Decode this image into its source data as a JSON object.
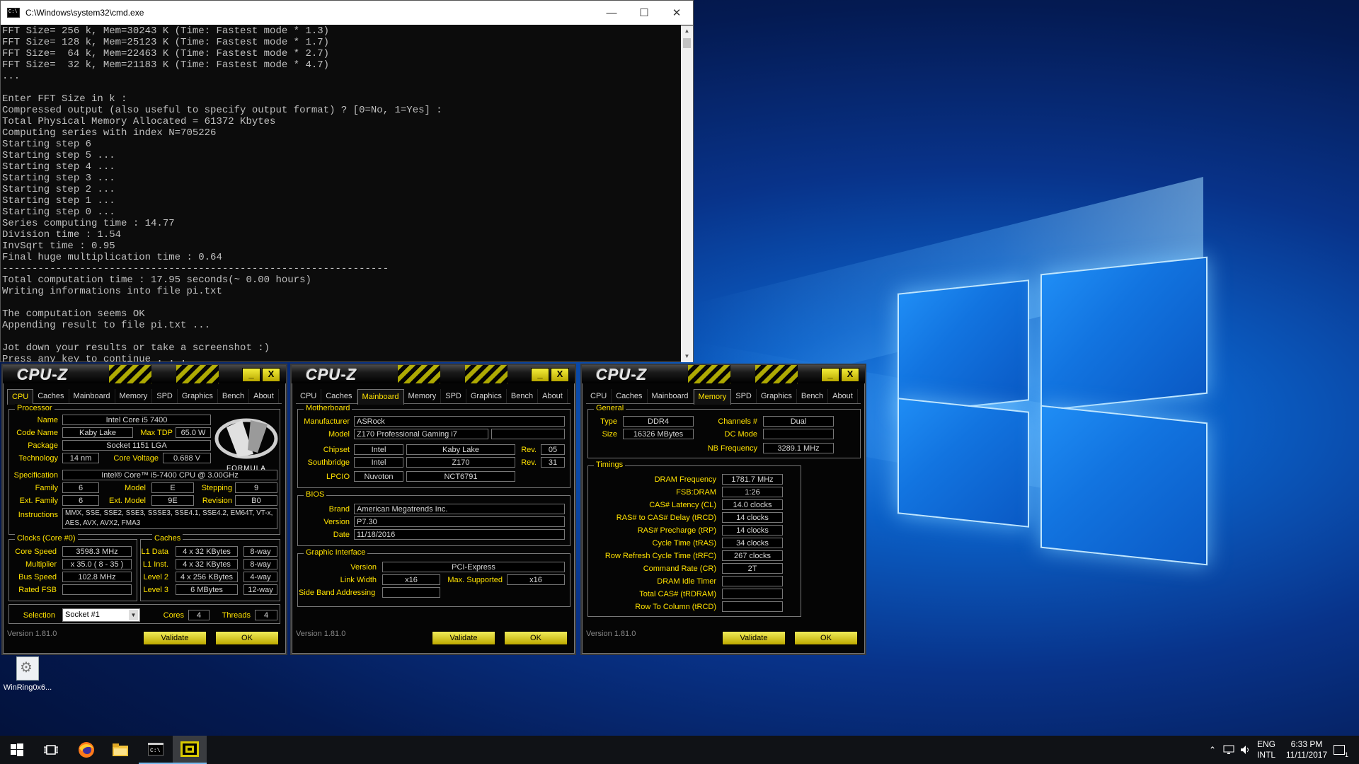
{
  "cmd": {
    "title": "C:\\Windows\\system32\\cmd.exe",
    "lines": [
      "FFT Size= 256 k, Mem=30243 K (Time: Fastest mode * 1.3)",
      "FFT Size= 128 k, Mem=25123 K (Time: Fastest mode * 1.7)",
      "FFT Size=  64 k, Mem=22463 K (Time: Fastest mode * 2.7)",
      "FFT Size=  32 k, Mem=21183 K (Time: Fastest mode * 4.7)",
      "...",
      "",
      "Enter FFT Size in k :",
      "Compressed output (also useful to specify output format) ? [0=No, 1=Yes] :",
      "Total Physical Memory Allocated = 61372 Kbytes",
      "Computing series with index N=705226",
      "Starting step 6",
      "Starting step 5 ...",
      "Starting step 4 ...",
      "Starting step 3 ...",
      "Starting step 2 ...",
      "Starting step 1 ...",
      "Starting step 0 ...",
      "Series computing time : 14.77",
      "Division time : 1.54",
      "InvSqrt time : 0.95",
      "Final huge multiplication time : 0.64",
      "-----------------------------------------------------------------",
      "Total computation time : 17.95 seconds(~ 0.00 hours)",
      "Writing informations into file pi.txt",
      "",
      "The computation seems OK",
      "Appending result to file pi.txt ...",
      "",
      "Jot down your results or take a screenshot :)",
      "Press any key to continue . . ."
    ]
  },
  "desktop": {
    "icon_label": "WinRing0x6..."
  },
  "cpuz_common": {
    "logo": "CPU-Z",
    "tabs": [
      "CPU",
      "Caches",
      "Mainboard",
      "Memory",
      "SPD",
      "Graphics",
      "Bench",
      "About"
    ],
    "version": "Version 1.81.0",
    "validate": "Validate",
    "ok": "OK",
    "minimize": "_",
    "close": "X"
  },
  "cpu": {
    "processor_title": "Processor",
    "name_lbl": "Name",
    "name": "Intel Core i5 7400",
    "codename_lbl": "Code Name",
    "codename": "Kaby Lake",
    "tdp_lbl": "Max TDP",
    "tdp": "65.0 W",
    "package_lbl": "Package",
    "package": "Socket 1151 LGA",
    "tech_lbl": "Technology",
    "tech": "14 nm",
    "voltage_lbl": "Core Voltage",
    "voltage": "0.688 V",
    "spec_lbl": "Specification",
    "spec": "Intel® Core™ i5-7400 CPU @ 3.00GHz",
    "family_lbl": "Family",
    "family": "6",
    "model_lbl": "Model",
    "model": "E",
    "stepping_lbl": "Stepping",
    "stepping": "9",
    "extfam_lbl": "Ext. Family",
    "extfam": "6",
    "extmodel_lbl": "Ext. Model",
    "extmodel": "9E",
    "revision_lbl": "Revision",
    "revision": "B0",
    "instr_lbl": "Instructions",
    "instr": "MMX, SSE, SSE2, SSE3, SSSE3, SSE4.1, SSE4.2, EM64T, VT-x, AES, AVX, AVX2, FMA3",
    "clocks_title": "Clocks (Core #0)",
    "corespeed_lbl": "Core Speed",
    "corespeed": "3598.3 MHz",
    "mult_lbl": "Multiplier",
    "mult": "x 35.0 ( 8 - 35 )",
    "bus_lbl": "Bus Speed",
    "bus": "102.8 MHz",
    "fsb_lbl": "Rated FSB",
    "fsb": "",
    "caches_title": "Caches",
    "l1d_lbl": "L1 Data",
    "l1d": "4 x 32 KBytes",
    "l1d_way": "8-way",
    "l1i_lbl": "L1 Inst.",
    "l1i": "4 x 32 KBytes",
    "l1i_way": "8-way",
    "l2_lbl": "Level 2",
    "l2": "4 x 256 KBytes",
    "l2_way": "4-way",
    "l3_lbl": "Level 3",
    "l3": "6 MBytes",
    "l3_way": "12-way",
    "sel_lbl": "Selection",
    "sel": "Socket #1",
    "cores_lbl": "Cores",
    "cores": "4",
    "threads_lbl": "Threads",
    "threads": "4",
    "badge": "FORMULA"
  },
  "mainboard": {
    "mb_title": "Motherboard",
    "manu_lbl": "Manufacturer",
    "manu": "ASRock",
    "model_lbl": "Model",
    "model": "Z170 Professional Gaming i7",
    "chipset_lbl": "Chipset",
    "chipset_v": "Intel",
    "chipset_n": "Kaby Lake",
    "rev_lbl": "Rev.",
    "chipset_rev": "05",
    "south_lbl": "Southbridge",
    "south_v": "Intel",
    "south_n": "Z170",
    "south_rev": "31",
    "lpcio_lbl": "LPCIO",
    "lpcio_v": "Nuvoton",
    "lpcio_n": "NCT6791",
    "bios_title": "BIOS",
    "brand_lbl": "Brand",
    "brand": "American Megatrends Inc.",
    "ver_lbl": "Version",
    "ver": "P7.30",
    "date_lbl": "Date",
    "date": "11/18/2016",
    "gi_title": "Graphic Interface",
    "giver_lbl": "Version",
    "giver": "PCI-Express",
    "lw_lbl": "Link Width",
    "lw": "x16",
    "ms_lbl": "Max. Supported",
    "ms": "x16",
    "sba_lbl": "Side Band Addressing",
    "sba": ""
  },
  "memory": {
    "gen_title": "General",
    "type_lbl": "Type",
    "type": "DDR4",
    "size_lbl": "Size",
    "size": "16326 MBytes",
    "ch_lbl": "Channels #",
    "ch": "Dual",
    "dc_lbl": "DC Mode",
    "dc": "",
    "nb_lbl": "NB Frequency",
    "nb": "3289.1 MHz",
    "tim_title": "Timings",
    "rows": [
      {
        "l": "DRAM Frequency",
        "v": "1781.7 MHz"
      },
      {
        "l": "FSB:DRAM",
        "v": "1:26"
      },
      {
        "l": "CAS# Latency (CL)",
        "v": "14.0 clocks"
      },
      {
        "l": "RAS# to CAS# Delay (tRCD)",
        "v": "14 clocks"
      },
      {
        "l": "RAS# Precharge (tRP)",
        "v": "14 clocks"
      },
      {
        "l": "Cycle Time (tRAS)",
        "v": "34 clocks"
      },
      {
        "l": "Row Refresh Cycle Time (tRFC)",
        "v": "267 clocks"
      },
      {
        "l": "Command Rate (CR)",
        "v": "2T"
      },
      {
        "l": "DRAM Idle Timer",
        "v": ""
      },
      {
        "l": "Total CAS# (tRDRAM)",
        "v": ""
      },
      {
        "l": "Row To Column (tRCD)",
        "v": ""
      }
    ]
  },
  "taskbar": {
    "lang1": "ENG",
    "lang2": "INTL",
    "time": "6:33 PM",
    "date": "11/11/2017",
    "notif_count": "1"
  }
}
